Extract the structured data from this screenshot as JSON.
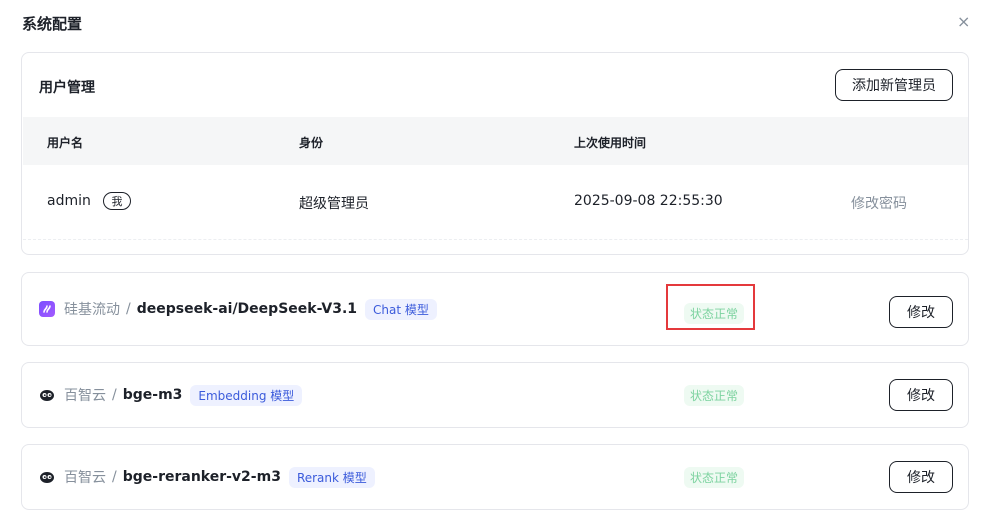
{
  "dialog": {
    "title": "系统配置",
    "close_glyph": "×"
  },
  "user_management": {
    "title": "用户管理",
    "add_button": "添加新管理员",
    "columns": [
      "用户名",
      "身份",
      "上次使用时间"
    ],
    "rows": [
      {
        "username": "admin",
        "me_badge": "我",
        "role": "超级管理员",
        "last_used": "2025-09-08 22:55:30",
        "action": "修改密码"
      }
    ]
  },
  "models": [
    {
      "provider": "硅基流动",
      "separator": "/",
      "name": "deepseek-ai/DeepSeek-V3.1",
      "tag": "Chat 模型",
      "status": "状态正常",
      "edit_label": "修改",
      "icon": "siliconflow-icon",
      "highlighted": true
    },
    {
      "provider": "百智云",
      "separator": "/",
      "name": "bge-m3",
      "tag": "Embedding 模型",
      "status": "状态正常",
      "edit_label": "修改",
      "icon": "baizhiyun-icon"
    },
    {
      "provider": "百智云",
      "separator": "/",
      "name": "bge-reranker-v2-m3",
      "tag": "Rerank 模型",
      "status": "状态正常",
      "edit_label": "修改",
      "icon": "baizhiyun-icon"
    }
  ],
  "colors": {
    "status_text": "#7dd3a0",
    "tag_text": "#3b5bdb",
    "highlight": "#e4393c"
  }
}
